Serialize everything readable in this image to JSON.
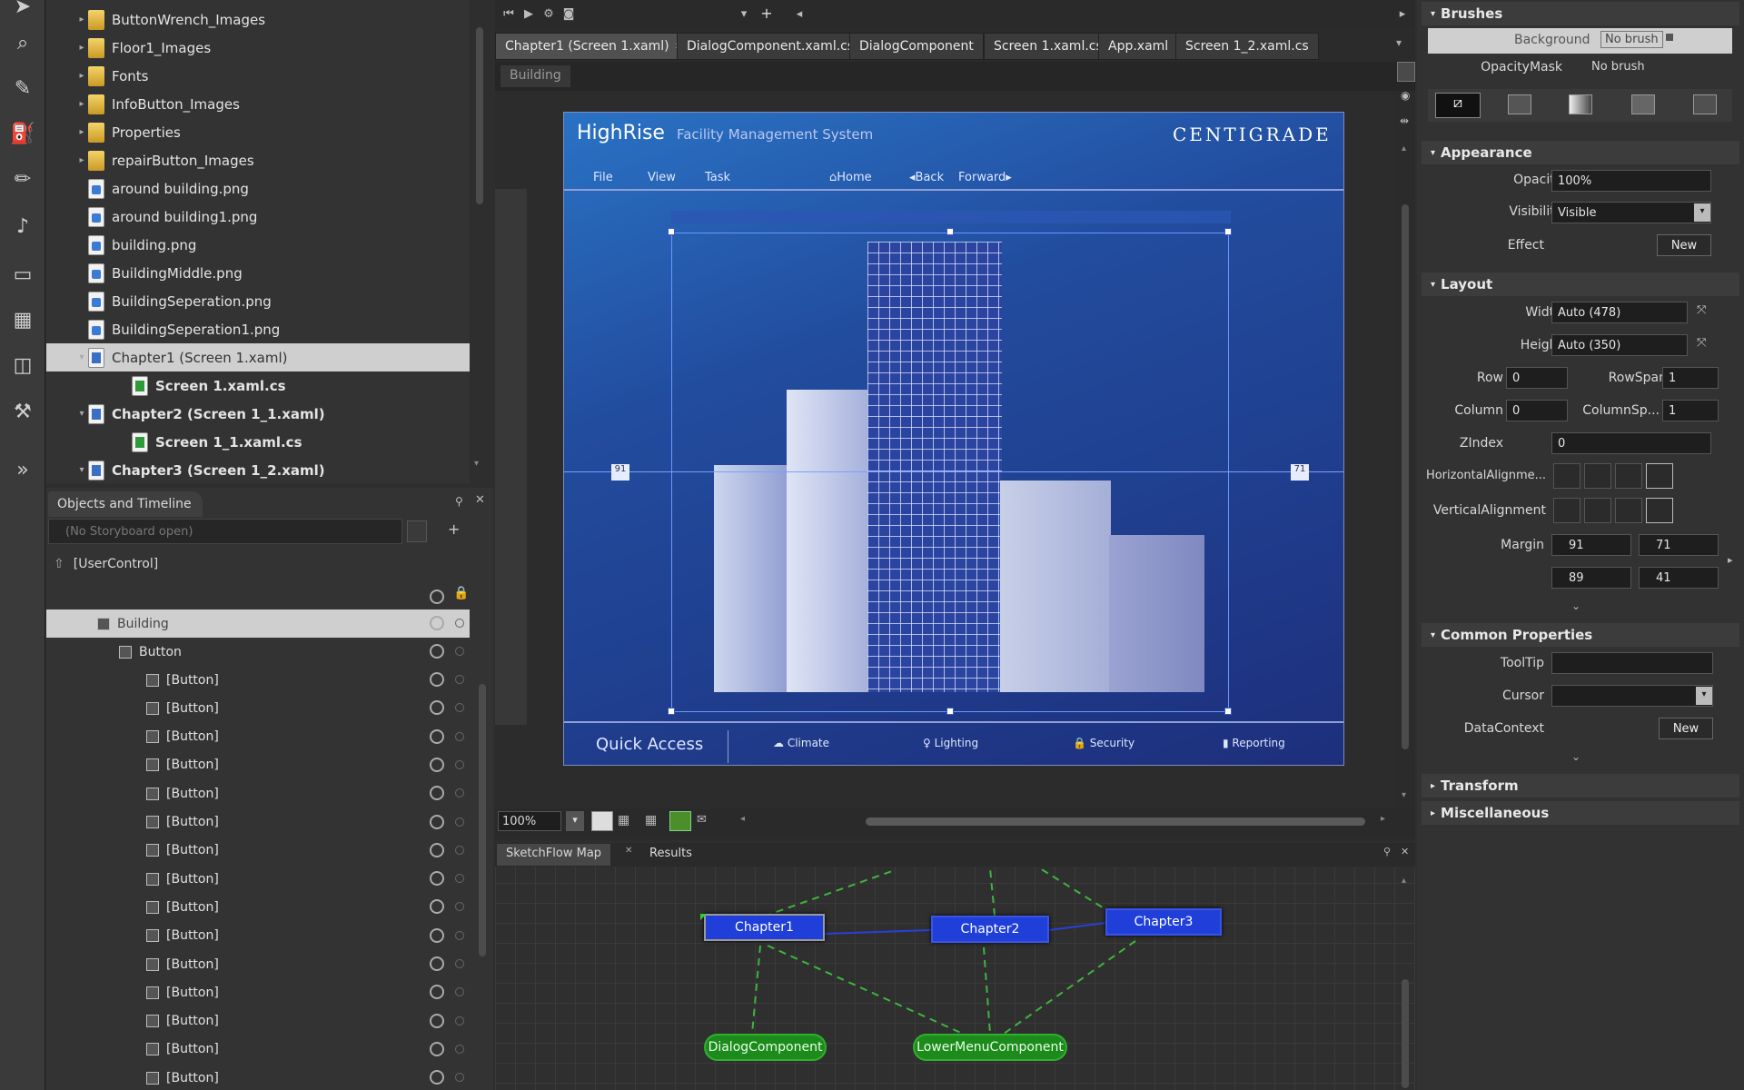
{
  "project": {
    "items": [
      {
        "label": "ButtonWrench_Images",
        "type": "folder",
        "expander": "▸",
        "indent": 0
      },
      {
        "label": "Floor1_Images",
        "type": "folder",
        "expander": "▸",
        "indent": 0
      },
      {
        "label": "Fonts",
        "type": "folder",
        "expander": "▸",
        "indent": 0
      },
      {
        "label": "InfoButton_Images",
        "type": "folder",
        "expander": "▸",
        "indent": 0
      },
      {
        "label": "Properties",
        "type": "folder",
        "expander": "▸",
        "indent": 0
      },
      {
        "label": "repairButton_Images",
        "type": "folder",
        "expander": "▸",
        "indent": 0
      },
      {
        "label": "around building.png",
        "type": "png",
        "expander": "",
        "indent": 0
      },
      {
        "label": "around building1.png",
        "type": "png",
        "expander": "",
        "indent": 0
      },
      {
        "label": "building.png",
        "type": "png",
        "expander": "",
        "indent": 0
      },
      {
        "label": "BuildingMiddle.png",
        "type": "png",
        "expander": "",
        "indent": 0
      },
      {
        "label": "BuildingSeperation.png",
        "type": "png",
        "expander": "",
        "indent": 0
      },
      {
        "label": "BuildingSeperation1.png",
        "type": "png",
        "expander": "",
        "indent": 0
      },
      {
        "label": "Chapter1 (Screen 1.xaml)",
        "type": "xaml",
        "expander": "▾",
        "indent": 0,
        "selected": true
      },
      {
        "label": "Screen 1.xaml.cs",
        "type": "cs",
        "expander": "",
        "indent": 1,
        "bold": true
      },
      {
        "label": "Chapter2 (Screen 1_1.xaml)",
        "type": "xaml",
        "expander": "▾",
        "indent": 0,
        "bold": true
      },
      {
        "label": "Screen 1_1.xaml.cs",
        "type": "cs",
        "expander": "",
        "indent": 1,
        "bold": true
      },
      {
        "label": "Chapter3 (Screen 1_2.xaml)",
        "type": "xaml",
        "expander": "▾",
        "indent": 0,
        "bold": true
      }
    ]
  },
  "objects": {
    "tab_label": "Objects and Timeline",
    "storyboard_placeholder": "(No Storyboard open)",
    "root_label": "[UserControl]",
    "building_label": "Building",
    "button_label": "Button",
    "child_label": "[Button]",
    "child_count": 15
  },
  "document": {
    "tabs": [
      {
        "label": "Chapter1 (Screen 1.xaml)",
        "active": true,
        "closable": true
      },
      {
        "label": "DialogComponent.xaml.cs"
      },
      {
        "label": "DialogComponent"
      },
      {
        "label": "Screen 1.xaml.cs"
      },
      {
        "label": "App.xaml"
      },
      {
        "label": "Screen 1_2.xaml.cs"
      }
    ],
    "breadcrumb": "Building",
    "zoom": "100%"
  },
  "artboard": {
    "app_title": "HighRise",
    "app_subtitle": "Facility Management System",
    "logo": "CENTIGRADE",
    "menu": [
      "File",
      "View",
      "Task"
    ],
    "nav": {
      "home": "Home",
      "back": "Back",
      "forward": "Forward"
    },
    "quick_access": "Quick Access",
    "bottom_items": [
      "Climate",
      "Lighting",
      "Security",
      "Reporting"
    ],
    "bar_label_left": "91",
    "bar_label_right": "71"
  },
  "sketchflow": {
    "tabs": [
      "SketchFlow Map",
      "Results"
    ],
    "nodes_blue": [
      "Chapter1",
      "Chapter2",
      "Chapter3"
    ],
    "nodes_green": [
      "DialogComponent",
      "LowerMenuComponent"
    ]
  },
  "properties": {
    "brushes_title": "Brushes",
    "background_label": "Background",
    "background_value": "No brush",
    "opacitymask_label": "OpacityMask",
    "opacitymask_value": "No brush",
    "appearance_title": "Appearance",
    "opacity_label": "Opacity",
    "opacity_value": "100%",
    "visibility_label": "Visibility",
    "visibility_value": "Visible",
    "effect_label": "Effect",
    "new_label": "New",
    "layout_title": "Layout",
    "width_label": "Width",
    "width_value": "Auto (478)",
    "height_label": "Height",
    "height_value": "Auto (350)",
    "row_label": "Row",
    "row_value": "0",
    "rowspan_label": "RowSpan",
    "rowspan_value": "1",
    "column_label": "Column",
    "column_value": "0",
    "columnspan_label": "ColumnSp...",
    "columnspan_value": "1",
    "zindex_label": "ZIndex",
    "zindex_value": "0",
    "halign_label": "HorizontalAlignme...",
    "valign_label": "VerticalAlignment",
    "margin_label": "Margin",
    "margin_left": "91",
    "margin_right": "71",
    "margin_top": "89",
    "margin_bottom": "41",
    "common_title": "Common Properties",
    "tooltip_label": "ToolTip",
    "cursor_label": "Cursor",
    "datacontext_label": "DataContext",
    "transform_title": "Transform",
    "misc_title": "Miscellaneous"
  }
}
